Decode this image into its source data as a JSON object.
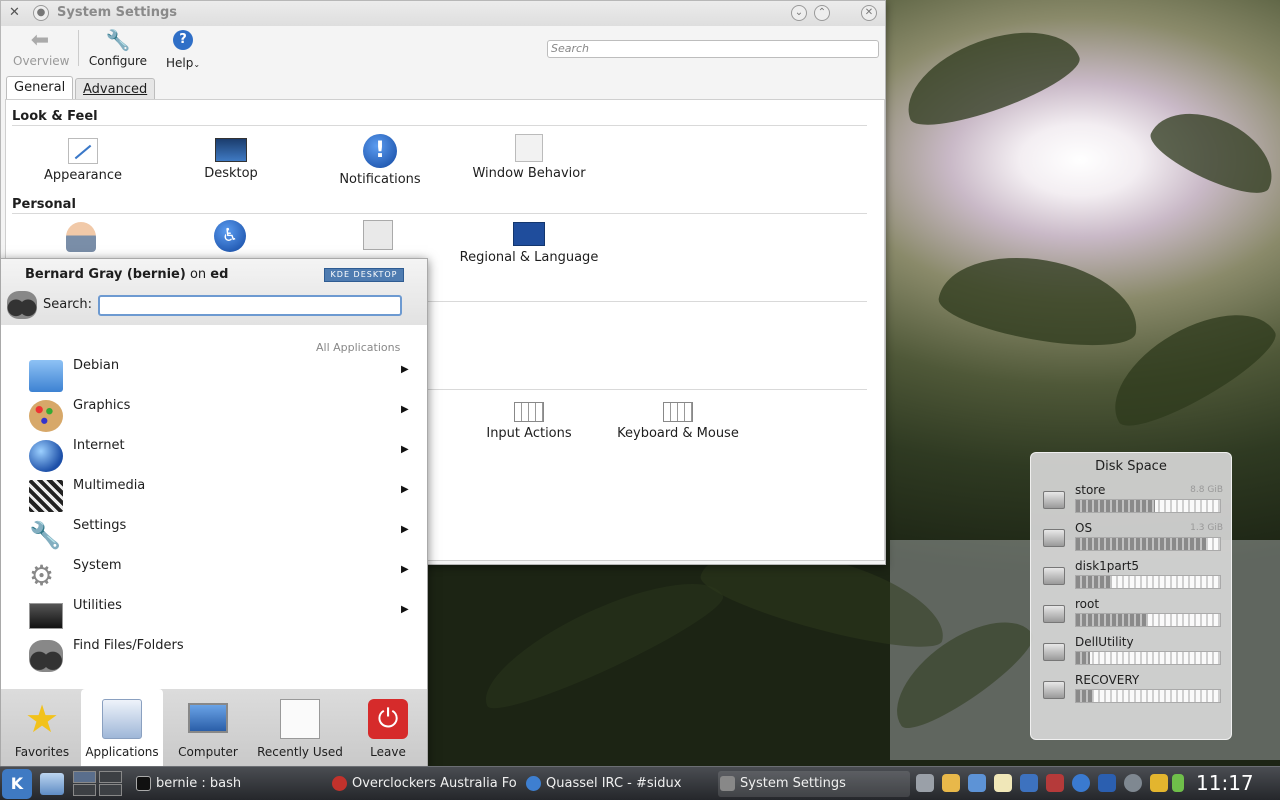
{
  "window": {
    "title": "System Settings",
    "toolbar": {
      "overview": "Overview",
      "configure": "Configure",
      "help": "Help"
    },
    "search_placeholder": "Search",
    "tabs": [
      "General",
      "Advanced"
    ],
    "sections": [
      {
        "title": "Look & Feel",
        "items": [
          "Appearance",
          "Desktop",
          "Notifications",
          "Window Behavior"
        ]
      },
      {
        "title": "Personal",
        "items": [
          "Regional & Language"
        ]
      }
    ],
    "hardware_items": [
      "Input Actions",
      "Keyboard & Mouse"
    ]
  },
  "menu": {
    "user_name": "Bernard Gray (bernie)",
    "on": "on",
    "host": "ed",
    "badge": "KDE DESKTOP",
    "search_label": "Search:",
    "breadcrumb": "All Applications",
    "items": [
      "Debian",
      "Graphics",
      "Internet",
      "Multimedia",
      "Settings",
      "System",
      "Utilities",
      "Find Files/Folders"
    ],
    "tabs": [
      "Favorites",
      "Applications",
      "Computer",
      "Recently Used",
      "Leave"
    ]
  },
  "disk_space": {
    "title": "Disk Space",
    "disks": [
      {
        "name": "store",
        "size": "8.8 GiB",
        "used": 0.55
      },
      {
        "name": "OS",
        "size": "1.3 GiB",
        "used": 0.9
      },
      {
        "name": "disk1part5",
        "size": "",
        "used": 0.25
      },
      {
        "name": "root",
        "size": "",
        "used": 0.5
      },
      {
        "name": "DellUtility",
        "size": "",
        "used": 0.1
      },
      {
        "name": "RECOVERY",
        "size": "",
        "used": 0.12
      }
    ]
  },
  "taskbar": {
    "tasks": [
      "bernie : bash",
      "Overclockers Australia Fo",
      "Quassel IRC - #sidux",
      "System Settings"
    ],
    "clock": "11:17"
  },
  "colors": {
    "accent": "#3f7ac3",
    "taskbar": "#2e3034",
    "search_focus": "#6d9ad1",
    "leave": "#d62b2b"
  }
}
